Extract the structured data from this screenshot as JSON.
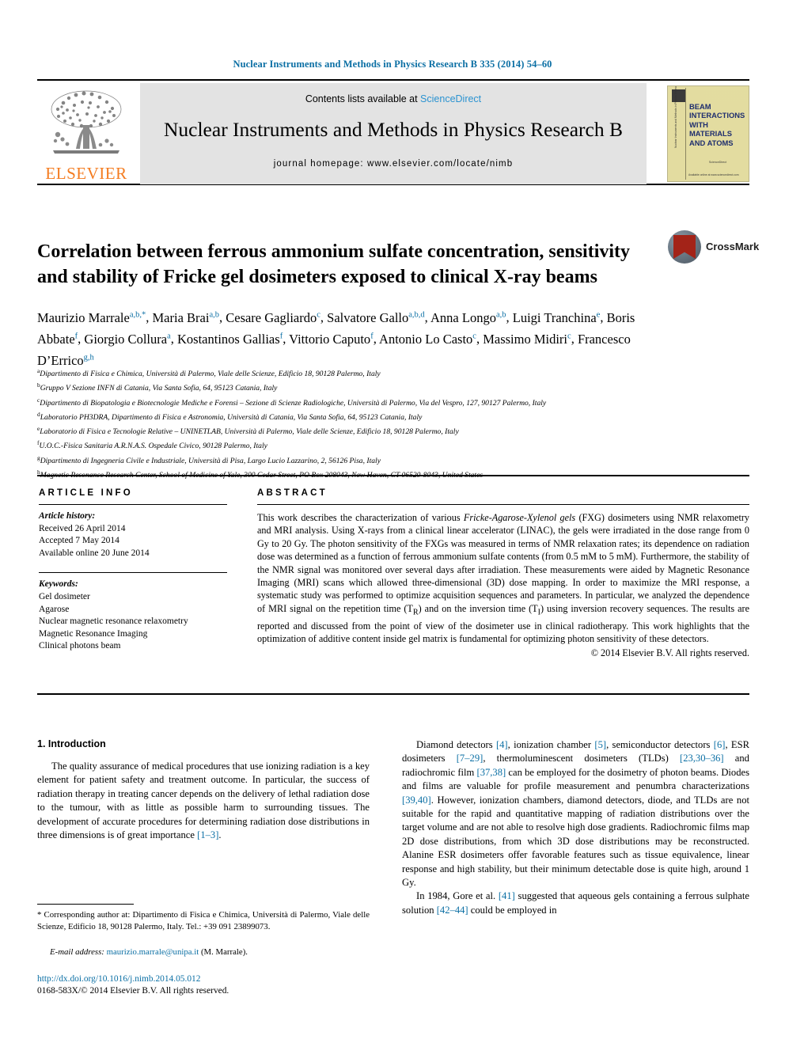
{
  "running_head": "Nuclear Instruments and Methods in Physics Research B 335 (2014) 54–60",
  "masthead": {
    "contents_prefix": "Contents lists available at ",
    "sciencedirect": "ScienceDirect",
    "journal_title": "Nuclear Instruments and Methods in Physics Research B",
    "homepage": "journal homepage: www.elsevier.com/locate/nimb",
    "publisher_wordmark": "ELSEVIER",
    "cover": {
      "title": "BEAM INTERACTIONS WITH MATERIALS AND ATOMS",
      "spine_text": "Nuclear Instruments and Methods in Physics Research B",
      "footer_line1": "ScienceDirect",
      "footer_line2": "Available online at www.sciencedirect.com"
    },
    "colors": {
      "link_blue": "#2b93d1",
      "elsevier_orange": "#f47c20",
      "band_gray": "#e3e3e3",
      "cover_yellow": "#efe8a8",
      "cover_navy": "#1f2e6e"
    }
  },
  "crossmark": {
    "label": "CrossMark"
  },
  "title": "Correlation between ferrous ammonium sulfate concentration, sensitivity and stability of Fricke gel dosimeters exposed to clinical X-ray beams",
  "authors": [
    {
      "name": "Maurizio Marrale",
      "sup": "a,b,*"
    },
    {
      "name": "Maria Brai",
      "sup": "a,b"
    },
    {
      "name": "Cesare Gagliardo",
      "sup": "c"
    },
    {
      "name": "Salvatore Gallo",
      "sup": "a,b,d"
    },
    {
      "name": "Anna Longo",
      "sup": "a,b"
    },
    {
      "name": "Luigi Tranchina",
      "sup": "e"
    },
    {
      "name": "Boris Abbate",
      "sup": "f"
    },
    {
      "name": "Giorgio Collura",
      "sup": "a"
    },
    {
      "name": "Kostantinos Gallias",
      "sup": "f"
    },
    {
      "name": "Vittorio Caputo",
      "sup": "f"
    },
    {
      "name": "Antonio Lo Casto",
      "sup": "c"
    },
    {
      "name": "Massimo Midiri",
      "sup": "c"
    },
    {
      "name": "Francesco D’Errico",
      "sup": "g,h"
    }
  ],
  "affiliations": [
    {
      "mark": "a",
      "text": "Dipartimento di Fisica e Chimica, Università di Palermo, Viale delle Scienze, Edificio 18, 90128 Palermo, Italy"
    },
    {
      "mark": "b",
      "text": "Gruppo V Sezione INFN di Catania, Via Santa Sofia, 64, 95123 Catania, Italy"
    },
    {
      "mark": "c",
      "text": "Dipartimento di Biopatologia e Biotecnologie Mediche e Forensi – Sezione di Scienze Radiologiche, Università di Palermo, Via del Vespro, 127, 90127 Palermo, Italy"
    },
    {
      "mark": "d",
      "text": "Laboratorio PH3DRA, Dipartimento di Fisica e Astronomia, Università di Catania, Via Santa Sofia, 64, 95123 Catania, Italy"
    },
    {
      "mark": "e",
      "text": "Laboratorio di Fisica e Tecnologie Relative – UNINETLAB, Università di Palermo, Viale delle Scienze, Edificio 18, 90128 Palermo, Italy"
    },
    {
      "mark": "f",
      "text": "U.O.C.-Fisica Sanitaria A.R.N.A.S. Ospedale Civico, 90128 Palermo, Italy"
    },
    {
      "mark": "g",
      "text": "Dipartimento di Ingegneria Civile e Industriale, Università di Pisa, Largo Lucio Lazzarino, 2, 56126 Pisa, Italy"
    },
    {
      "mark": "h",
      "text": "Magnetic Resonance Research Center, School of Medicine of Yale, 300 Cedar Street, PO Box 208043, New Haven, CT 06520-8043, United States"
    }
  ],
  "article_info": {
    "heading": "ARTICLE INFO",
    "history_label": "Article history:",
    "history": [
      "Received 26 April 2014",
      "Accepted 7 May 2014",
      "Available online 20 June 2014"
    ],
    "keywords_label": "Keywords:",
    "keywords": [
      "Gel dosimeter",
      "Agarose",
      "Nuclear magnetic resonance relaxometry",
      "Magnetic Resonance Imaging",
      "Clinical photons beam"
    ]
  },
  "abstract": {
    "heading": "ABSTRACT",
    "part1": "This work describes the characterization of various ",
    "italic1": "Fricke-Agarose-Xylenol gels",
    "part2": " (FXG) dosimeters using NMR relaxometry and MRI analysis. Using X-rays from a clinical linear accelerator (LINAC), the gels were irradiated in the dose range from 0 Gy to 20 Gy. The photon sensitivity of the FXGs was measured in terms of NMR relaxation rates; its dependence on radiation dose was determined as a function of ferrous ammonium sulfate contents (from 0.5 mM to 5 mM). Furthermore, the stability of the NMR signal was monitored over several days after irradiation. These measurements were aided by Magnetic Resonance Imaging (MRI) scans which allowed three-dimensional (3D) dose mapping. In order to maximize the MRI response, a systematic study was performed to optimize acquisition sequences and parameters. In particular, we analyzed the dependence of MRI signal on the repetition time (T",
    "sub1": "R",
    "part3": ") and on the inversion time (T",
    "sub2": "I",
    "part4": ") using inversion recovery sequences. The results are reported and discussed from the point of view of the dosimeter use in clinical radiotherapy. This work highlights that the optimization of additive content inside gel matrix is fundamental for optimizing photon sensitivity of these detectors.",
    "copyright": "© 2014 Elsevier B.V. All rights reserved."
  },
  "body": {
    "section_heading": "1. Introduction",
    "left_p1_a": "The quality assurance of medical procedures that use ionizing radiation is a key element for patient safety and treatment outcome. In particular, the success of radiation therapy in treating cancer depends on the delivery of lethal radiation dose to the tumour, with as little as possible harm to surrounding tissues. The development of accurate procedures for determining radiation dose distributions in three dimensions is of great importance ",
    "left_p1_ref": "[1–3]",
    "left_p1_b": ".",
    "right_p1_a": "Diamond detectors ",
    "right_p1_r1": "[4]",
    "right_p1_b": ", ionization chamber ",
    "right_p1_r2": "[5]",
    "right_p1_c": ", semiconductor detectors ",
    "right_p1_r3": "[6]",
    "right_p1_d": ", ESR dosimeters ",
    "right_p1_r4": "[7–29]",
    "right_p1_e": ", thermoluminescent dosimeters (TLDs) ",
    "right_p1_r5": "[23,30–36]",
    "right_p1_f": " and radiochromic film ",
    "right_p1_r6": "[37,38]",
    "right_p1_g": " can be employed for the dosimetry of photon beams. Diodes and films are valuable for profile measurement and penumbra characterizations ",
    "right_p1_r7": "[39,40]",
    "right_p1_h": ". However, ionization chambers, diamond detectors, diode, and TLDs are not suitable for the rapid and quantitative mapping of radiation distributions over the target volume and are not able to resolve high dose gradients. Radiochromic films map 2D dose distributions, from which 3D dose distributions may be reconstructed. Alanine ESR dosimeters offer favorable features such as tissue equivalence, linear response and high stability, but their minimum detectable dose is quite high, around 1 Gy.",
    "right_p2_a": "In 1984, Gore et al. ",
    "right_p2_r1": "[41]",
    "right_p2_b": " suggested that aqueous gels containing a ferrous sulphate solution ",
    "right_p2_r2": "[42–44]",
    "right_p2_c": " could be employed in"
  },
  "footnotes": {
    "corresponding_star": "*",
    "corresponding": " Corresponding author at: Dipartimento di Fisica e Chimica, Università di Palermo, Viale delle Scienze, Edificio 18, 90128 Palermo, Italy. Tel.: +39 091 23899073.",
    "email_label": "E-mail address:",
    "email": "maurizio.marrale@unipa.it",
    "email_suffix": " (M. Marrale).",
    "doi": "http://dx.doi.org/10.1016/j.nimb.2014.05.012",
    "issn": "0168-583X/© 2014 Elsevier B.V. All rights reserved."
  }
}
